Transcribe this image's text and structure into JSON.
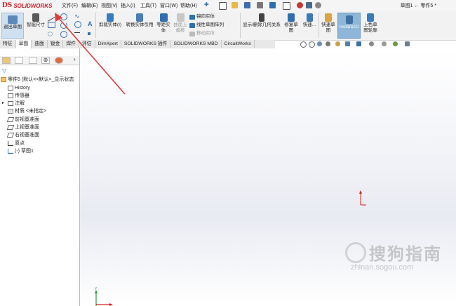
{
  "app": {
    "logo_mark": "DS",
    "logo_text": "SOLIDWORKS",
    "doc_title": "草图1 ← 零件5 *"
  },
  "menu": [
    "文件(F)",
    "编辑(E)",
    "视图(V)",
    "插入(I)",
    "工具(T)",
    "窗口(W)",
    "帮助(H)"
  ],
  "ribbon": {
    "exit_sketch": "退出草图",
    "smart_dim": "智能尺寸",
    "trim": "剪裁实体(I)",
    "convert": "转换实体引用",
    "offset_l1": "等距实",
    "offset_l2": "体",
    "surface_l1": "曲面上",
    "surface_l2": "偏移",
    "mirror": "镜向实体",
    "linear_pattern": "线性草图阵列",
    "move": "移动实体",
    "relations": "显示/删除几何关系",
    "repair_l1": "修复草",
    "repair_l2": "图",
    "quick_snap": "快速...",
    "rapid_l1": "快速草",
    "rapid_l2": "图",
    "instant2d": "Instant2D",
    "shaded_l1": "上色草",
    "shaded_l2": "图轮廓"
  },
  "tabs": [
    "特征",
    "草图",
    "曲面",
    "钣金",
    "焊件",
    "评估",
    "DimXpert",
    "SOLIDWORKS 插件",
    "SOLIDWORKS MBD",
    "CircuitWorks"
  ],
  "active_tab": "草图",
  "tree": {
    "root": "零件5 (默认<<默认>_显示状态",
    "items": [
      "History",
      "传感器",
      "注解",
      "材质 <未指定>",
      "前视基准面",
      "上视基准面",
      "右视基准面",
      "原点",
      "(-) 草图1"
    ]
  },
  "watermark": {
    "text": "搜狗指南",
    "url": "zhinan.sogou.com"
  },
  "axes": {
    "y": "Y",
    "x": "X"
  },
  "colors": {
    "accent": "#2f6fb0",
    "annotation_arrow": "#e03a3a",
    "origin": "#d62020",
    "instant2d_bg": "#8eb6d8"
  }
}
